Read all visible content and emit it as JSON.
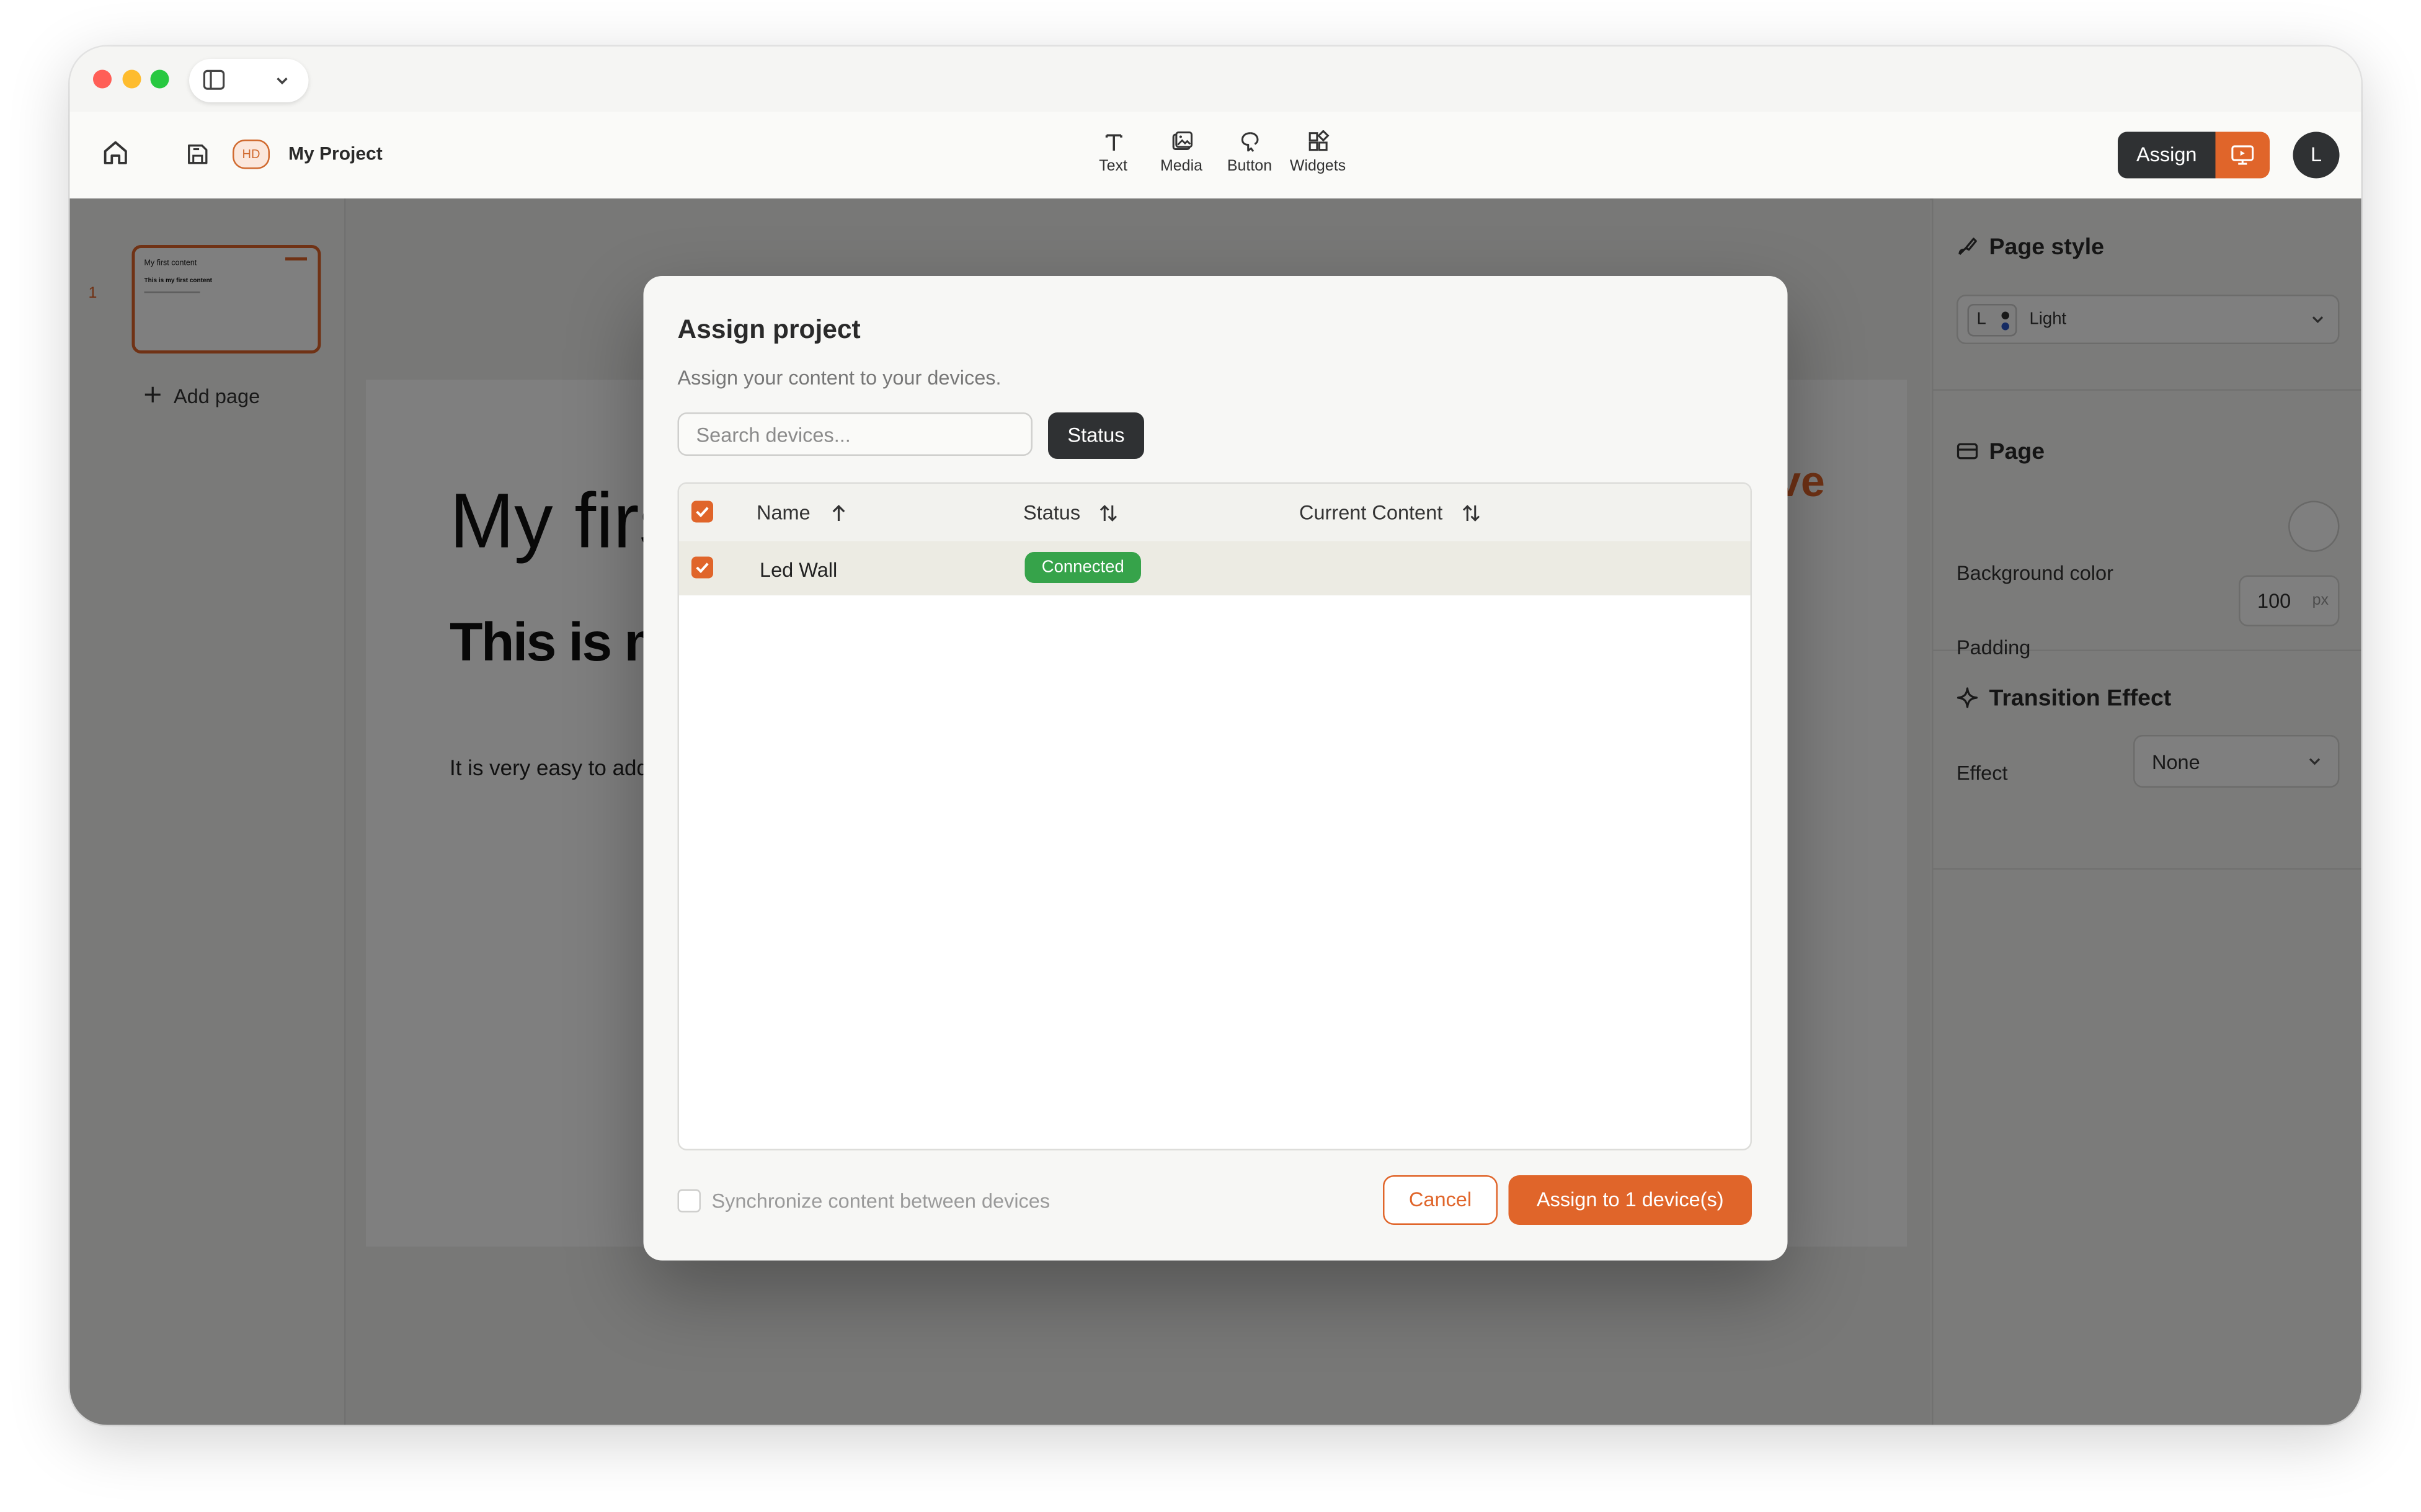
{
  "toolbar": {
    "project_title": "My Project",
    "quality_badge": "HD",
    "tools": [
      {
        "label": "Text",
        "icon": "text-icon"
      },
      {
        "label": "Media",
        "icon": "media-icon"
      },
      {
        "label": "Button",
        "icon": "button-icon"
      },
      {
        "label": "Widgets",
        "icon": "widgets-icon"
      }
    ],
    "assign_label": "Assign",
    "avatar_initial": "L"
  },
  "left_panel": {
    "page_number": "1",
    "add_page_label": "Add page",
    "thumbnail": {
      "title": "My first content",
      "subtitle": "This is my first content"
    }
  },
  "canvas": {
    "heading": "My first content",
    "subheading": "This is my first content",
    "paragraph": "It is very easy to add content",
    "accent_text": "ve"
  },
  "right_panel": {
    "page_style_title": "Page style",
    "theme_badge": "L",
    "theme_value": "Light",
    "page_title": "Page",
    "background_color_label": "Background color",
    "padding_label": "Padding",
    "padding_value": "100",
    "padding_unit": "px",
    "transition_title": "Transition Effect",
    "effect_label": "Effect",
    "effect_value": "None"
  },
  "modal": {
    "title": "Assign project",
    "subtitle": "Assign your content to your devices.",
    "search_placeholder": "Search devices...",
    "status_filter_label": "Status",
    "columns": {
      "name": "Name",
      "status": "Status",
      "current_content": "Current Content"
    },
    "rows": [
      {
        "name": "Led Wall",
        "status": "Connected",
        "current_content": "",
        "selected": true
      }
    ],
    "sync_label": "Synchronize content between devices",
    "cancel_label": "Cancel",
    "assign_label": "Assign to 1 device(s)"
  },
  "colors": {
    "accent": "#e0652a",
    "dark": "#2f3133",
    "connected": "#36a34a",
    "traffic_red": "#ff5f57",
    "traffic_yellow": "#febc2e",
    "traffic_green": "#28c840"
  }
}
